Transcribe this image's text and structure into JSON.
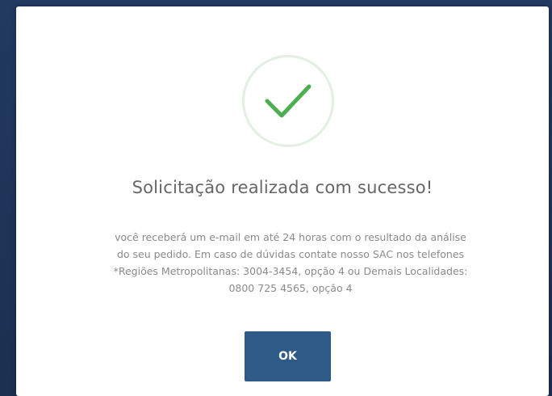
{
  "modal": {
    "icon": "check-icon",
    "title": "Solicitação realizada com sucesso!",
    "message_lines": [
      "você receberá um e-mail em até 24 horas com o resultado da análise",
      "do seu pedido. Em caso de dúvidas contate nosso SAC nos telefones",
      "*Regiões Metropolitanas: 3004-3454, opção 4 ou Demais Localidades:",
      "0800 725 4565, opção 4"
    ],
    "ok_label": "OK"
  },
  "colors": {
    "backdrop": "#1e3356",
    "check": "#4caf50",
    "button": "#2e5a87"
  }
}
